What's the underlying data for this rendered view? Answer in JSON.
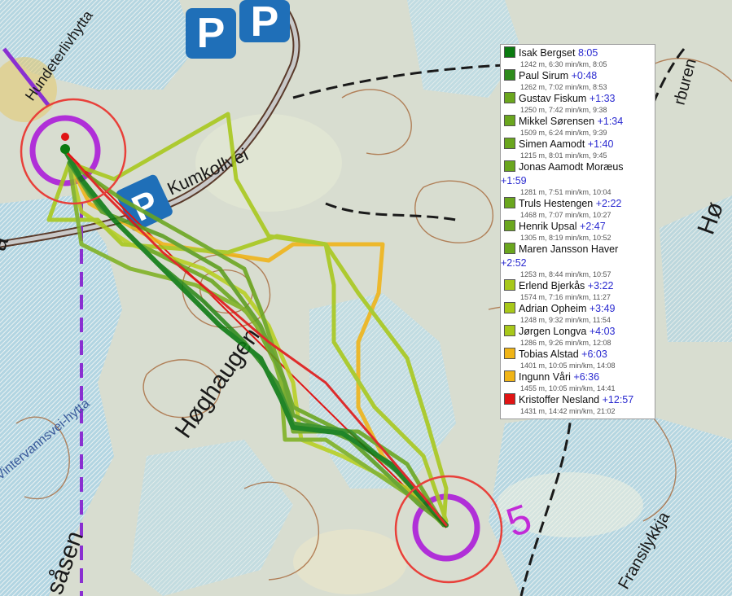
{
  "map": {
    "labels": {
      "parking_1": "P",
      "parking_2": "P",
      "parking_3": "P",
      "road_name": "Kumkollvei",
      "hill_name": "Høghaugen",
      "trail_name": "Vintervannsvei-hytta",
      "saasen": "såsen",
      "fransilykkja": "Fransilykkja",
      "top_left_text": "Hundeterlivhytta",
      "right_edge": "Hø",
      "left_edge": "a",
      "top_right": "rburen",
      "control_number": "5"
    }
  },
  "legend": {
    "runners": [
      {
        "name": "Isak Bergset",
        "diff": "8:05",
        "stats": "1242 m, 6:30 min/km, 8:05",
        "color": "#0a7a10"
      },
      {
        "name": "Paul Sirum",
        "diff": "+0:48",
        "stats": "1262 m, 7:02 min/km, 8:53",
        "color": "#2e8b1c"
      },
      {
        "name": "Gustav Fiskum",
        "diff": "+1:33",
        "stats": "1250 m, 7:42 min/km, 9:38",
        "color": "#6aa61e"
      },
      {
        "name": "Mikkel Sørensen",
        "diff": "+1:34",
        "stats": "1509 m, 6:24 min/km, 9:39",
        "color": "#6aa61e"
      },
      {
        "name": "Simen Aamodt",
        "diff": "+1:40",
        "stats": "1215 m, 8:01 min/km, 9:45",
        "color": "#6aa61e"
      },
      {
        "name": "Jonas Aamodt Moræus",
        "diff": "+1:59",
        "stats": "1281 m, 7:51 min/km, 10:04",
        "color": "#6aa61e",
        "wrap": true
      },
      {
        "name": "Truls Hestengen",
        "diff": "+2:22",
        "stats": "1468 m, 7:07 min/km, 10:27",
        "color": "#6aa61e"
      },
      {
        "name": "Henrik Upsal",
        "diff": "+2:47",
        "stats": "1305 m, 8:19 min/km, 10:52",
        "color": "#6aa61e"
      },
      {
        "name": "Maren Jansson Haver",
        "diff": "+2:52",
        "stats": "1253 m, 8:44 min/km, 10:57",
        "color": "#6aa61e",
        "wrap": true
      },
      {
        "name": "Erlend Bjerkås",
        "diff": "+3:22",
        "stats": "1574 m, 7:16 min/km, 11:27",
        "color": "#a8c81a"
      },
      {
        "name": "Adrian Opheim",
        "diff": "+3:49",
        "stats": "1248 m, 9:32 min/km, 11:54",
        "color": "#a8c81a"
      },
      {
        "name": "Jørgen Longva",
        "diff": "+4:03",
        "stats": "1286 m, 9:26 min/km, 12:08",
        "color": "#a8c81a"
      },
      {
        "name": "Tobias Alstad",
        "diff": "+6:03",
        "stats": "1401 m, 10:05 min/km, 14:08",
        "color": "#f0b416"
      },
      {
        "name": "Ingunn Våri",
        "diff": "+6:36",
        "stats": "1455 m, 10:05 min/km, 14:41",
        "color": "#f0b416"
      },
      {
        "name": "Kristoffer Nesland",
        "diff": "+12:57",
        "stats": "1431 m, 14:42 min/km, 21:02",
        "color": "#e01414"
      }
    ]
  }
}
